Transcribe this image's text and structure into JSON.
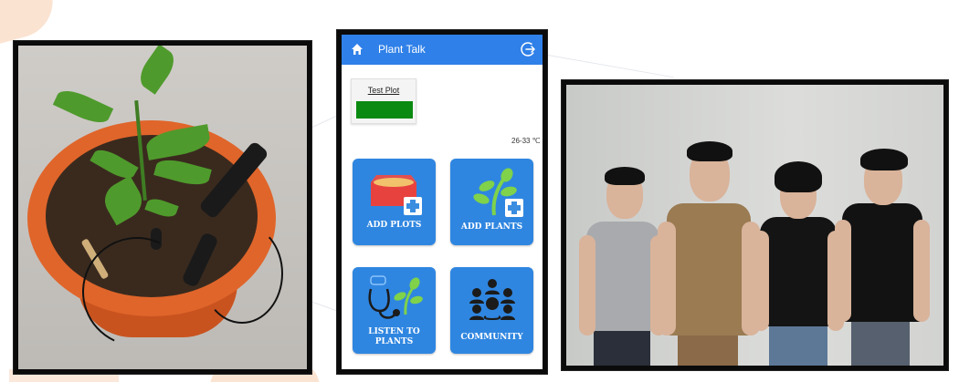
{
  "app": {
    "title": "Plant Talk",
    "plot_card": {
      "name": "Test Plot",
      "status_color": "#0b8a12"
    },
    "temperature": "26-33 ℃",
    "tiles": [
      {
        "label": "ADD PLOTS",
        "icon": "plot-box-plus-icon"
      },
      {
        "label": "ADD PLANTS",
        "icon": "plant-plus-icon"
      },
      {
        "label": "LISTEN TO PLANTS",
        "icon": "stethoscope-plant-icon"
      },
      {
        "label": "COMMUNITY",
        "icon": "people-group-icon"
      }
    ],
    "header_color": "#2f80e8",
    "tile_color": "#2f86e0"
  },
  "photos": {
    "plant": "potted-plant-with-sensor-probes-photo",
    "team": "four-team-members-photo"
  }
}
